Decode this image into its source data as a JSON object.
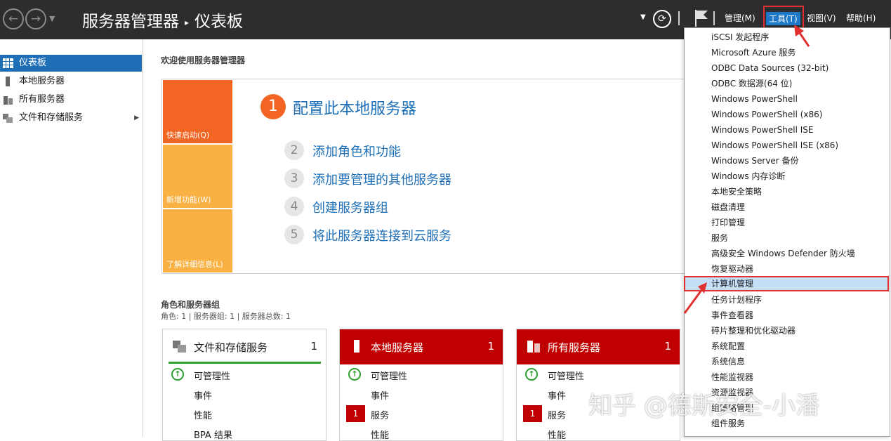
{
  "titlebar": {
    "back": "←",
    "forward": "→",
    "breadcrumb_app": "服务器管理器",
    "breadcrumb_sep": "▸",
    "breadcrumb_page": "仪表板",
    "menu": {
      "manage": "管理(M)",
      "tools": "工具(T)",
      "view": "视图(V)",
      "help": "帮助(H)"
    }
  },
  "sidebar": {
    "items": [
      {
        "label": "仪表板",
        "icon": "dashboard-icon",
        "active": true
      },
      {
        "label": "本地服务器",
        "icon": "server-icon"
      },
      {
        "label": "所有服务器",
        "icon": "servers-icon"
      },
      {
        "label": "文件和存储服务",
        "icon": "storage-icon",
        "expand": "▶"
      }
    ]
  },
  "welcome": "欢迎使用服务器管理器",
  "quickstart": {
    "tiles": [
      "快速启动(Q)",
      "新增功能(W)",
      "了解详细信息(L)"
    ],
    "steps": [
      {
        "num": "1",
        "text": "配置此本地服务器"
      },
      {
        "num": "2",
        "text": "添加角色和功能"
      },
      {
        "num": "3",
        "text": "添加要管理的其他服务器"
      },
      {
        "num": "4",
        "text": "创建服务器组"
      },
      {
        "num": "5",
        "text": "将此服务器连接到云服务"
      }
    ]
  },
  "roles": {
    "title": "角色和服务器组",
    "subtitle": "角色: 1 | 服务器组: 1 | 服务器总数: 1",
    "cards": [
      {
        "title": "文件和存储服务",
        "count": "1",
        "rows": [
          "可管理性",
          "事件",
          "性能",
          "BPA 结果"
        ]
      },
      {
        "title": "本地服务器",
        "count": "1",
        "rows": [
          "可管理性",
          "事件",
          "服务",
          "性能"
        ],
        "badge": "1"
      },
      {
        "title": "所有服务器",
        "count": "1",
        "rows": [
          "可管理性",
          "事件",
          "服务",
          "性能"
        ],
        "badge": "1"
      }
    ]
  },
  "tools_menu": {
    "items": [
      "iSCSI 发起程序",
      "Microsoft Azure 服务",
      "ODBC Data Sources (32-bit)",
      "ODBC 数据源(64 位)",
      "Windows PowerShell",
      "Windows PowerShell (x86)",
      "Windows PowerShell ISE",
      "Windows PowerShell ISE (x86)",
      "Windows Server 备份",
      "Windows 内存诊断",
      "本地安全策略",
      "磁盘清理",
      "打印管理",
      "服务",
      "高级安全 Windows Defender 防火墙",
      "恢复驱动器",
      "计算机管理",
      "任务计划程序",
      "事件查看器",
      "碎片整理和优化驱动器",
      "系统配置",
      "系统信息",
      "性能监视器",
      "资源监视器",
      "组策略管理",
      "组件服务"
    ],
    "highlighted": "计算机管理"
  },
  "watermark": "知乎 @德斯安全-小潘",
  "colors": {
    "titlebar": "#2d2d30",
    "accent_blue": "#1e6fb6",
    "orange": "#f26522",
    "tile_light": "#f8b142",
    "red": "#c00000",
    "highlight": "#c5dff6",
    "annotation": "#e03030"
  }
}
